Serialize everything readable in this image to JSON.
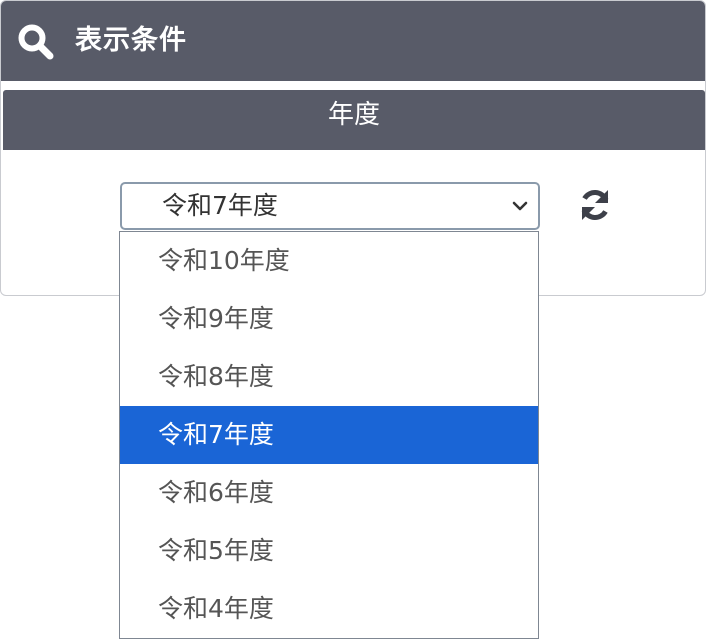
{
  "panel": {
    "title": "表示条件",
    "icon": "search-icon",
    "header_color": "#585b68"
  },
  "fiscal_year": {
    "label": "年度",
    "selected": "令和7年度",
    "refresh_icon": "refresh-icon",
    "options": [
      {
        "label": "令和10年度",
        "selected": false
      },
      {
        "label": "令和9年度",
        "selected": false
      },
      {
        "label": "令和8年度",
        "selected": false
      },
      {
        "label": "令和7年度",
        "selected": true
      },
      {
        "label": "令和6年度",
        "selected": false
      },
      {
        "label": "令和5年度",
        "selected": false
      },
      {
        "label": "令和4年度",
        "selected": false
      }
    ],
    "highlight_color": "#1a65d6"
  }
}
